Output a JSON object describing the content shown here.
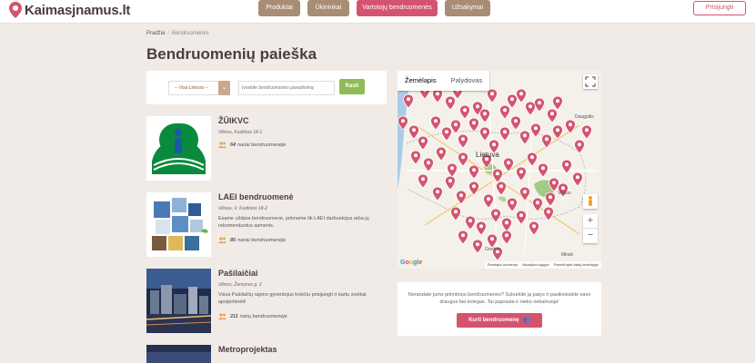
{
  "header": {
    "logo_text": "Kaimasjnamus.lt",
    "nav": [
      {
        "label": "Produktai"
      },
      {
        "label": "Ūkininkai"
      },
      {
        "label": "Vartotojų bendruomenės"
      },
      {
        "label": "Užsakymai"
      }
    ],
    "login_label": "Prisijungti",
    "colors": {
      "brand": "#d4546f",
      "nav": "#a88c74",
      "green": "#8fbc56"
    }
  },
  "breadcrumb": {
    "home": "Pradžia",
    "current": "Bendruomenės"
  },
  "page_title": "Bendruomenių paieška",
  "search": {
    "region_value": "-- Visa Lietuva --",
    "name_placeholder": "Įveskite bendruomenės pavadinimą",
    "find_label": "Rasti"
  },
  "communities": [
    {
      "name": "ŽŪIKVC",
      "address": "Vilnius, Kudirkos 18-1",
      "description": "",
      "members_count": "64",
      "members_text": "nariai bendruomenėje"
    },
    {
      "name": "LAEI bendruomenė",
      "address": "Vilnius, V. Kudirkos 18-2",
      "description": "Esame uždara bendruomenė, priimame tik LAEI darbuotojus arba jų rekomenduotus asmenis.",
      "members_count": "85",
      "members_text": "nariai bendruomenėje"
    },
    {
      "name": "Pašilaičiai",
      "address": "Vilnius, Žemynos g. 2",
      "description": "Visus Pašilaičių rajono gyventojus kviečiu prisijungti ir kartu sveikai apsipirkinėti!",
      "members_count": "211",
      "members_text": "narių bendruomenėje"
    },
    {
      "name": "Metroprojektas",
      "address": "",
      "description": "",
      "members_count": "",
      "members_text": ""
    }
  ],
  "map": {
    "tab_map": "Žemėlapis",
    "tab_satellite": "Palydovas",
    "country_label": "Lietuva",
    "cities": [
      "Daugpilis",
      "Vilnius",
      "Minsk",
      "Grodno"
    ],
    "google_label": "Google",
    "attribution": [
      "Žemėlapio duomenys",
      "Naudojimo sąlygos",
      "Pranešti apie klaidą žemėlapyje"
    ],
    "zoom_in": "+",
    "zoom_out": "−"
  },
  "cta": {
    "text": "Nerandate jums priimtinos bendruomenės? Sukurkite ją patys ir pasikvieskite savo draugus bei kolegas. Tai paprasta ir nieko nekainuoja!",
    "button_label": "Kurti bendruomenę"
  }
}
